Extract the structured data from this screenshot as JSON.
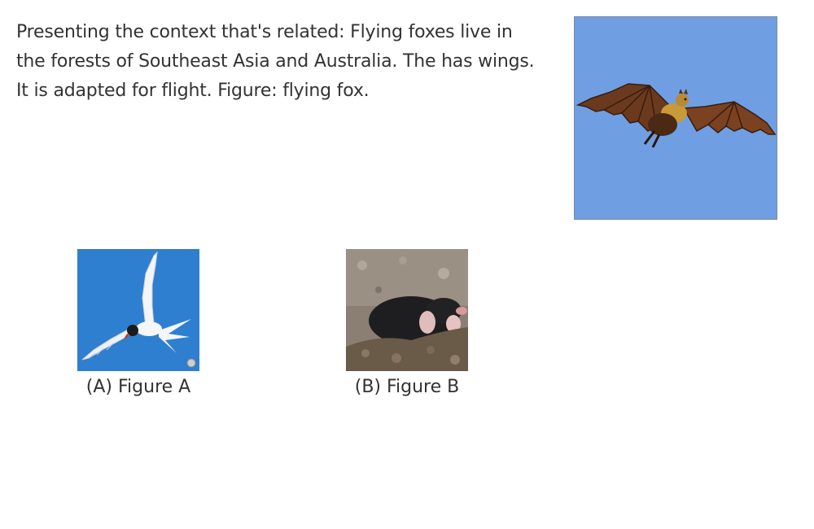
{
  "question": {
    "context_text": "Presenting the context that's related: Flying foxes live in the forests of Southeast Asia and Australia. The has wings. It is adapted for flight. Figure: flying fox."
  },
  "main_figure": {
    "icon": "flying-fox-photo",
    "sky_color": "#6f9fe2"
  },
  "options": [
    {
      "label": "(A) Figure A",
      "icon": "arctic-tern-photo",
      "bg_color": "#2e7fd0"
    },
    {
      "label": "(B) Figure B",
      "icon": "mole-photo",
      "bg_color": "#7a6e62"
    }
  ]
}
